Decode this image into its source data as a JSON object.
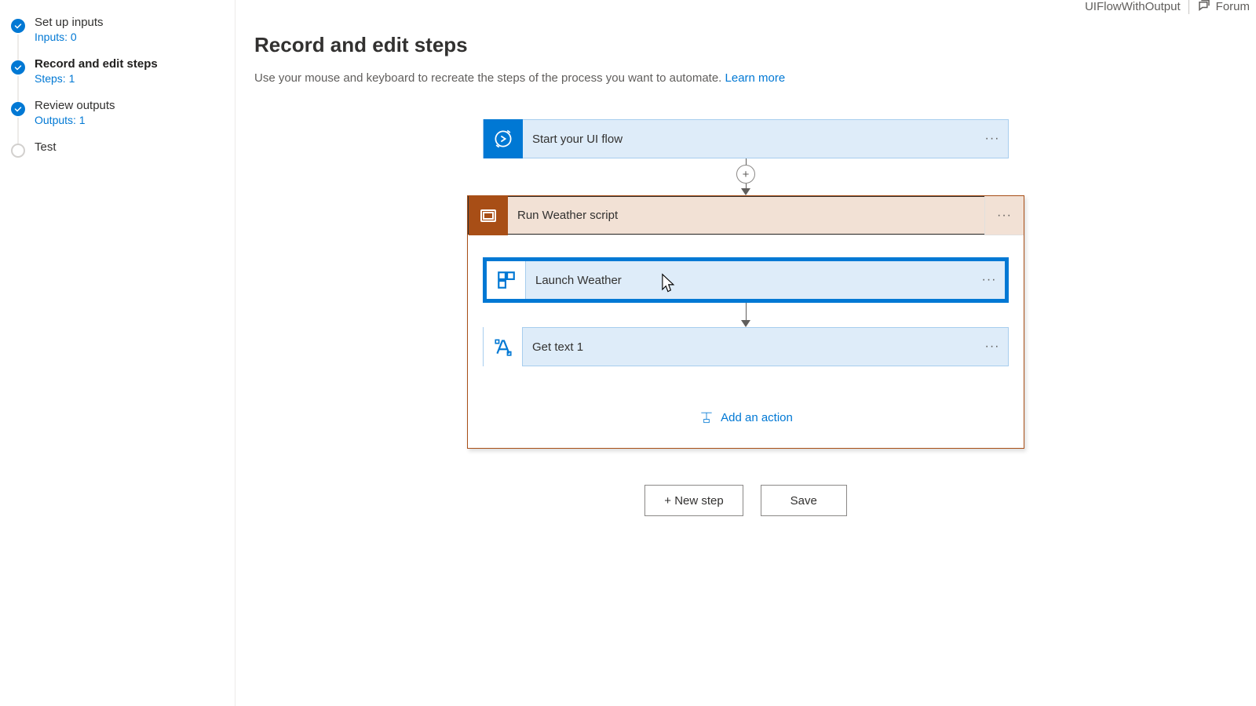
{
  "header": {
    "flow_name": "UIFlowWithOutput",
    "forum_label": "Forum"
  },
  "sidebar": {
    "steps": [
      {
        "title": "Set up inputs",
        "meta": "Inputs: 0",
        "state": "done"
      },
      {
        "title": "Record and edit steps",
        "meta": "Steps: 1",
        "state": "current"
      },
      {
        "title": "Review outputs",
        "meta": "Outputs: 1",
        "state": "done"
      },
      {
        "title": "Test",
        "meta": "",
        "state": "pending"
      }
    ]
  },
  "page": {
    "title": "Record and edit steps",
    "description": "Use your mouse and keyboard to recreate the steps of the process you want to automate. ",
    "learn_more": "Learn more"
  },
  "flow": {
    "start_label": "Start your UI flow",
    "group_title": "Run Weather script",
    "group_children": {
      "launch_label": "Launch Weather",
      "gettext_label": "Get text 1"
    },
    "add_action_label": "Add an action",
    "new_step_label": "+ New step",
    "save_label": "Save"
  }
}
